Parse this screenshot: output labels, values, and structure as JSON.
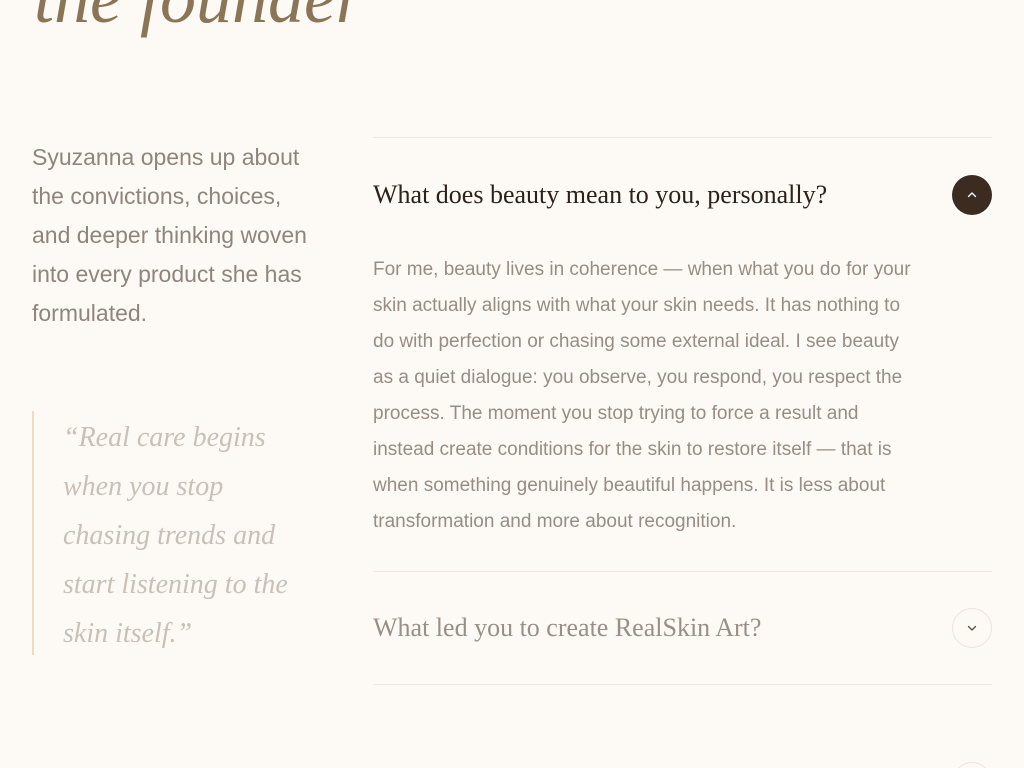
{
  "hero": {
    "title": "the founder"
  },
  "intro": {
    "text": "Syuzanna opens up about the convictions, choices, and deeper thinking woven into every product she has formulated."
  },
  "quote": {
    "text": "“Real care begins when you stop chasing trends and start listening to the skin itself.”"
  },
  "faq": {
    "items": [
      {
        "question": "What does beauty mean to you, personally?",
        "answer": "For me, beauty lives in coherence — when what you do for your skin actually aligns with what your skin needs. It has nothing to do with perfection or chasing some external ideal. I see beauty as a quiet dialogue: you observe, you respond, you respect the process. The moment you stop trying to force a result and instead create conditions for the skin to restore itself — that is when something genuinely beautiful happens. It is less about transformation and more about recognition.",
        "expanded": true,
        "icon": "chevron-up-icon"
      },
      {
        "question": "What led you to create RealSkin Art?",
        "expanded": false,
        "icon": "chevron-down-icon"
      }
    ]
  },
  "colors": {
    "background": "#fdfaf5",
    "accent_dark": "#3b2b20",
    "heading": "#8a7556",
    "body_text": "#978d85",
    "quote_text": "#c9c0b7",
    "divider": "#efe7de"
  }
}
